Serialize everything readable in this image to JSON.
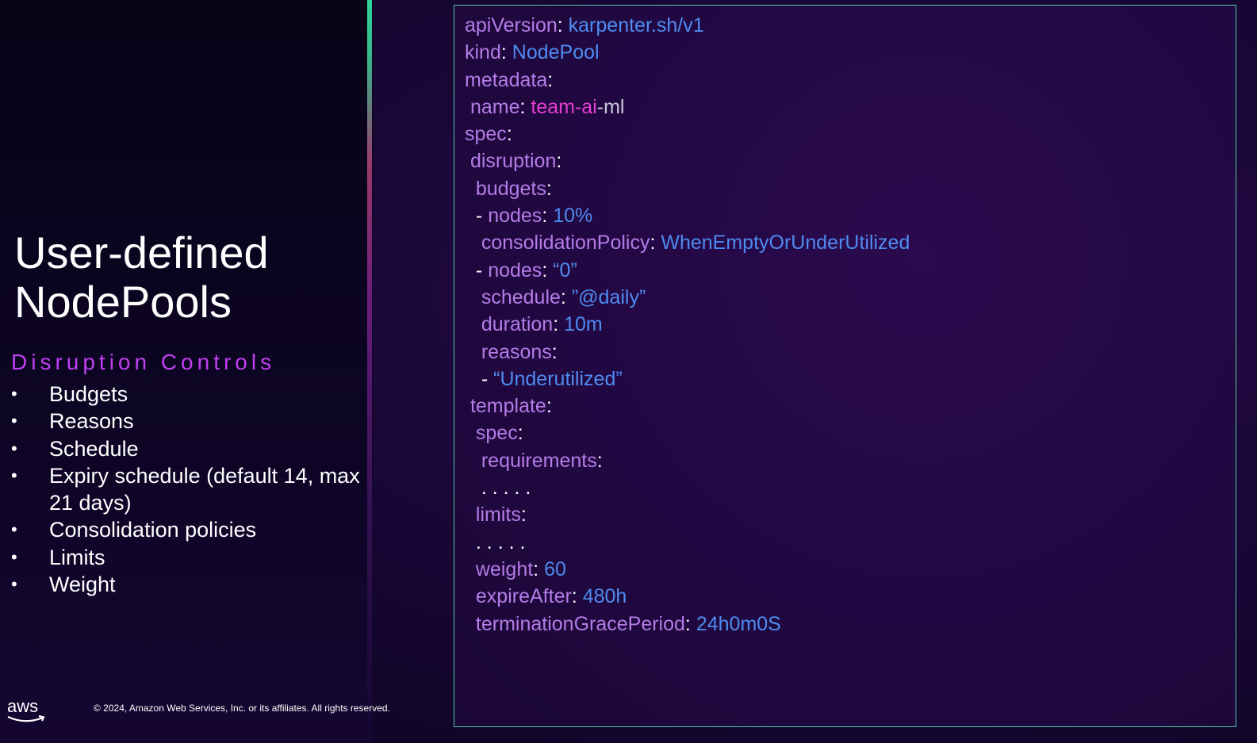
{
  "slide": {
    "title": "User-defined\nNodePools",
    "subtitle": "Disruption Controls",
    "bullets": [
      "Budgets",
      "Reasons",
      "Schedule",
      "Expiry schedule (default 14, max 21 days)",
      "Consolidation policies",
      "Limits",
      "Weight"
    ],
    "bullet_char": "•",
    "copyright": "© 2024, Amazon Web Services, Inc. or its affiliates. All rights reserved.",
    "logo_text": "aws",
    "logo_icon": "aws-smile-arrow-icon"
  },
  "code": {
    "lines": [
      {
        "indent": "",
        "prefix": "",
        "key": "apiVersion",
        "value": "karpenter.sh/v1",
        "vclass": "v"
      },
      {
        "indent": "",
        "prefix": "",
        "key": "kind",
        "value": "NodePool",
        "vclass": "v"
      },
      {
        "indent": "",
        "prefix": "",
        "key": "metadata",
        "value": "",
        "vclass": "v"
      },
      {
        "indent": " ",
        "prefix": "",
        "key": "name",
        "value": "team-ai",
        "vclass": "m",
        "value2": "-ml"
      },
      {
        "indent": "",
        "prefix": "",
        "key": "spec",
        "value": "",
        "vclass": "v"
      },
      {
        "indent": " ",
        "prefix": "",
        "key": "disruption",
        "value": "",
        "vclass": "v"
      },
      {
        "indent": "  ",
        "prefix": "",
        "key": "budgets",
        "value": "",
        "vclass": "v"
      },
      {
        "indent": "  ",
        "prefix": "- ",
        "key": "nodes",
        "value": "10%",
        "vclass": "v"
      },
      {
        "indent": "   ",
        "prefix": "",
        "key": "consolidationPolicy",
        "value": "WhenEmptyOrUnderUtilized",
        "vclass": "v"
      },
      {
        "indent": "  ",
        "prefix": "- ",
        "key": "nodes",
        "value": "“0”",
        "vclass": "v"
      },
      {
        "indent": "   ",
        "prefix": "",
        "key": "schedule",
        "value": "”@daily”",
        "vclass": "v"
      },
      {
        "indent": "   ",
        "prefix": "",
        "key": "duration",
        "value": "10m",
        "vclass": "v"
      },
      {
        "indent": "   ",
        "prefix": "",
        "key": "reasons",
        "value": "",
        "vclass": "v"
      },
      {
        "indent": "   ",
        "prefix": "- ",
        "key": "",
        "value": "“Underutilized”",
        "vclass": "v"
      },
      {
        "indent": " ",
        "prefix": "",
        "key": "template",
        "value": "",
        "vclass": "v"
      },
      {
        "indent": "  ",
        "prefix": "",
        "key": "spec",
        "value": "",
        "vclass": "v"
      },
      {
        "indent": "   ",
        "prefix": "",
        "key": "requirements",
        "value": "",
        "vclass": "v"
      },
      {
        "indent": "   ",
        "prefix": "",
        "key": "",
        "value": ". . . . .",
        "vclass": "p"
      },
      {
        "indent": "  ",
        "prefix": "",
        "key": "limits",
        "value": "",
        "vclass": "v"
      },
      {
        "indent": "  ",
        "prefix": "",
        "key": "",
        "value": ". . . . .",
        "vclass": "p"
      },
      {
        "indent": "  ",
        "prefix": "",
        "key": "weight",
        "value": "60",
        "vclass": "v"
      },
      {
        "indent": "  ",
        "prefix": "",
        "key": "expireAfter",
        "value": "480h",
        "vclass": "v"
      },
      {
        "indent": "  ",
        "prefix": "",
        "key": "terminationGracePeriod",
        "value": "24h0m0S",
        "vclass": "v"
      }
    ]
  },
  "colors": {
    "key": "#b57ce8",
    "value": "#4f8bf0",
    "highlight": "#e63fd2",
    "subtitle": "#c040f0",
    "panel_border": "#4fc7a6"
  }
}
